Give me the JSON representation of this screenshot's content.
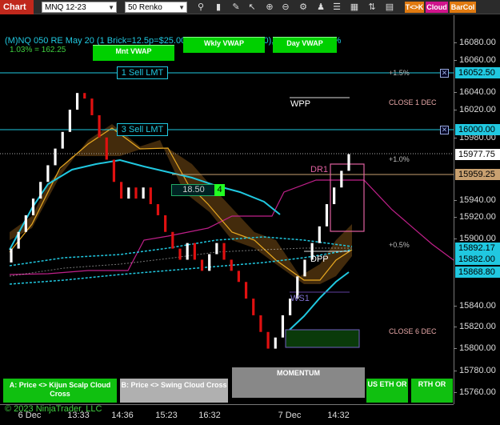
{
  "toolbar": {
    "chart_tab": "Chart",
    "instrument": "MNQ 12-23",
    "bar_type": "50 Renko",
    "icons": [
      "search-icon",
      "bar-style-icon",
      "draw-icon",
      "cursor-icon",
      "zoom-in-icon",
      "zoom-out-icon",
      "indicators-icon",
      "strategies-icon",
      "properties-icon",
      "window-icon",
      "chart-trader-icon",
      "data-box-icon"
    ],
    "buttons": [
      {
        "label": "T<>K",
        "color": "#e07a10"
      },
      {
        "label": "Cloud",
        "color": "#d0148c"
      },
      {
        "label": "BarCol",
        "color": "#e07a10"
      }
    ]
  },
  "info": {
    "line1": "(M)NQ 050 RE May 20 (1 Brick=12.5p=$25.00) (1%=130p=$260.00), US Daily RTH %",
    "line2": "1.03% = 162.25"
  },
  "vwap": {
    "month": "Mnt VWAP",
    "weekly": "Wkly VWAP",
    "day": "Day VWAP"
  },
  "orders": {
    "sell1": "1 Sell LMT",
    "sell3": "3 Sell LMT",
    "cancel_icon": "close-icon"
  },
  "labels": {
    "plus15": "+1.5%",
    "plus10": "+1.0%",
    "plus05": "+0.5%",
    "close_1dec": "CLOSE 1 DEC",
    "close_6dec": "CLOSE 6 DEC",
    "wpp": "WPP",
    "dr1": "DR1",
    "dpp": "DPP",
    "ws1": "WS1",
    "box_value": "18.50",
    "box_count": "4"
  },
  "yaxis": {
    "ticks": [
      "16080.00",
      "16060.00",
      "16040.00",
      "16020.00",
      "15980.00",
      "15940.00",
      "15920.00",
      "15900.00",
      "15840.00",
      "15820.00",
      "15800.00",
      "15780.00",
      "15760.00"
    ],
    "markers": [
      {
        "label": "16052.50",
        "bg": "#20c8e0"
      },
      {
        "label": "16000.00",
        "bg": "#20c8e0"
      },
      {
        "label": "15977.75",
        "bg": "#ffffff"
      },
      {
        "label": "15959.25",
        "bg": "#c8a070"
      },
      {
        "label": "15892.17",
        "bg": "#20c8e0"
      },
      {
        "label": "15882.00",
        "bg": "#20c8e0"
      },
      {
        "label": "15868.80",
        "bg": "#20c8e0"
      }
    ]
  },
  "xaxis": {
    "ticks": [
      "6 Dec",
      "13:33",
      "14:36",
      "15:23",
      "16:32",
      "7 Dec",
      "14:32"
    ]
  },
  "bottom": {
    "kijun": "A: Price <> Kijun Scalp Cloud Cross",
    "swing": "B: Price <> Swing Cloud Cross",
    "momentum": "MOMENTUM",
    "us_eth": "US ETH OR",
    "rth": "RTH OR"
  },
  "copyright": "© 2023 NinjaTrader, LLC",
  "chart_data": {
    "type": "renko",
    "instrument": "MNQ 12-23",
    "brick_size": 12.5,
    "ylim": [
      15750,
      16100
    ],
    "grid": false,
    "last_price": 15977.75,
    "bricks_close": [
      15890,
      15905,
      15920,
      15935,
      15950,
      15965,
      15980,
      15995,
      16015,
      16030,
      16025,
      16010,
      15990,
      15970,
      15950,
      15935,
      15945,
      15935,
      15945,
      15930,
      15920,
      15905,
      15890,
      15880,
      15895,
      15880,
      15870,
      15885,
      15895,
      15880,
      15870,
      15860,
      15845,
      15830,
      15815,
      15800,
      15810,
      15830,
      15845,
      15865,
      15880,
      15895,
      15910,
      15930,
      15945,
      15960,
      15975
    ]
  }
}
